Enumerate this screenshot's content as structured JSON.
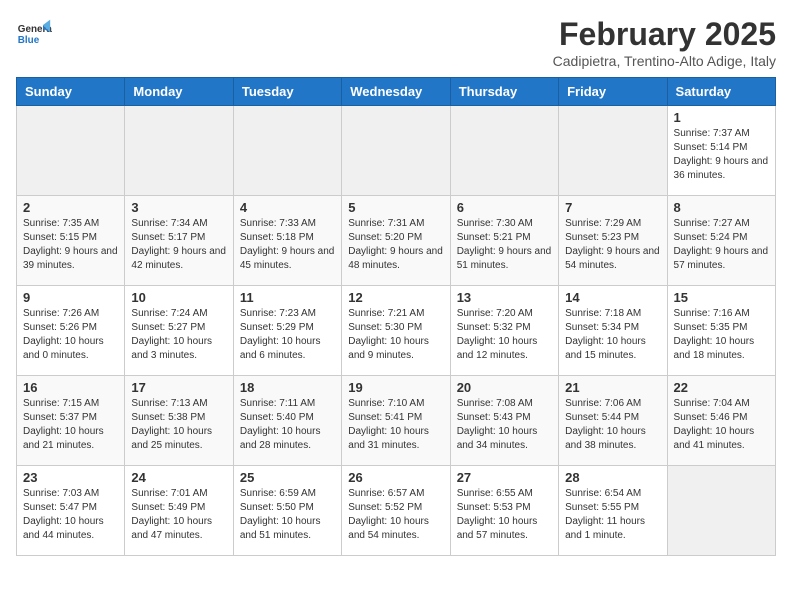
{
  "header": {
    "logo_general": "General",
    "logo_blue": "Blue",
    "month": "February 2025",
    "location": "Cadipietra, Trentino-Alto Adige, Italy"
  },
  "weekdays": [
    "Sunday",
    "Monday",
    "Tuesday",
    "Wednesday",
    "Thursday",
    "Friday",
    "Saturday"
  ],
  "weeks": [
    [
      {
        "day": "",
        "info": ""
      },
      {
        "day": "",
        "info": ""
      },
      {
        "day": "",
        "info": ""
      },
      {
        "day": "",
        "info": ""
      },
      {
        "day": "",
        "info": ""
      },
      {
        "day": "",
        "info": ""
      },
      {
        "day": "1",
        "info": "Sunrise: 7:37 AM\nSunset: 5:14 PM\nDaylight: 9 hours and 36 minutes."
      }
    ],
    [
      {
        "day": "2",
        "info": "Sunrise: 7:35 AM\nSunset: 5:15 PM\nDaylight: 9 hours and 39 minutes."
      },
      {
        "day": "3",
        "info": "Sunrise: 7:34 AM\nSunset: 5:17 PM\nDaylight: 9 hours and 42 minutes."
      },
      {
        "day": "4",
        "info": "Sunrise: 7:33 AM\nSunset: 5:18 PM\nDaylight: 9 hours and 45 minutes."
      },
      {
        "day": "5",
        "info": "Sunrise: 7:31 AM\nSunset: 5:20 PM\nDaylight: 9 hours and 48 minutes."
      },
      {
        "day": "6",
        "info": "Sunrise: 7:30 AM\nSunset: 5:21 PM\nDaylight: 9 hours and 51 minutes."
      },
      {
        "day": "7",
        "info": "Sunrise: 7:29 AM\nSunset: 5:23 PM\nDaylight: 9 hours and 54 minutes."
      },
      {
        "day": "8",
        "info": "Sunrise: 7:27 AM\nSunset: 5:24 PM\nDaylight: 9 hours and 57 minutes."
      }
    ],
    [
      {
        "day": "9",
        "info": "Sunrise: 7:26 AM\nSunset: 5:26 PM\nDaylight: 10 hours and 0 minutes."
      },
      {
        "day": "10",
        "info": "Sunrise: 7:24 AM\nSunset: 5:27 PM\nDaylight: 10 hours and 3 minutes."
      },
      {
        "day": "11",
        "info": "Sunrise: 7:23 AM\nSunset: 5:29 PM\nDaylight: 10 hours and 6 minutes."
      },
      {
        "day": "12",
        "info": "Sunrise: 7:21 AM\nSunset: 5:30 PM\nDaylight: 10 hours and 9 minutes."
      },
      {
        "day": "13",
        "info": "Sunrise: 7:20 AM\nSunset: 5:32 PM\nDaylight: 10 hours and 12 minutes."
      },
      {
        "day": "14",
        "info": "Sunrise: 7:18 AM\nSunset: 5:34 PM\nDaylight: 10 hours and 15 minutes."
      },
      {
        "day": "15",
        "info": "Sunrise: 7:16 AM\nSunset: 5:35 PM\nDaylight: 10 hours and 18 minutes."
      }
    ],
    [
      {
        "day": "16",
        "info": "Sunrise: 7:15 AM\nSunset: 5:37 PM\nDaylight: 10 hours and 21 minutes."
      },
      {
        "day": "17",
        "info": "Sunrise: 7:13 AM\nSunset: 5:38 PM\nDaylight: 10 hours and 25 minutes."
      },
      {
        "day": "18",
        "info": "Sunrise: 7:11 AM\nSunset: 5:40 PM\nDaylight: 10 hours and 28 minutes."
      },
      {
        "day": "19",
        "info": "Sunrise: 7:10 AM\nSunset: 5:41 PM\nDaylight: 10 hours and 31 minutes."
      },
      {
        "day": "20",
        "info": "Sunrise: 7:08 AM\nSunset: 5:43 PM\nDaylight: 10 hours and 34 minutes."
      },
      {
        "day": "21",
        "info": "Sunrise: 7:06 AM\nSunset: 5:44 PM\nDaylight: 10 hours and 38 minutes."
      },
      {
        "day": "22",
        "info": "Sunrise: 7:04 AM\nSunset: 5:46 PM\nDaylight: 10 hours and 41 minutes."
      }
    ],
    [
      {
        "day": "23",
        "info": "Sunrise: 7:03 AM\nSunset: 5:47 PM\nDaylight: 10 hours and 44 minutes."
      },
      {
        "day": "24",
        "info": "Sunrise: 7:01 AM\nSunset: 5:49 PM\nDaylight: 10 hours and 47 minutes."
      },
      {
        "day": "25",
        "info": "Sunrise: 6:59 AM\nSunset: 5:50 PM\nDaylight: 10 hours and 51 minutes."
      },
      {
        "day": "26",
        "info": "Sunrise: 6:57 AM\nSunset: 5:52 PM\nDaylight: 10 hours and 54 minutes."
      },
      {
        "day": "27",
        "info": "Sunrise: 6:55 AM\nSunset: 5:53 PM\nDaylight: 10 hours and 57 minutes."
      },
      {
        "day": "28",
        "info": "Sunrise: 6:54 AM\nSunset: 5:55 PM\nDaylight: 11 hours and 1 minute."
      },
      {
        "day": "",
        "info": ""
      }
    ]
  ]
}
